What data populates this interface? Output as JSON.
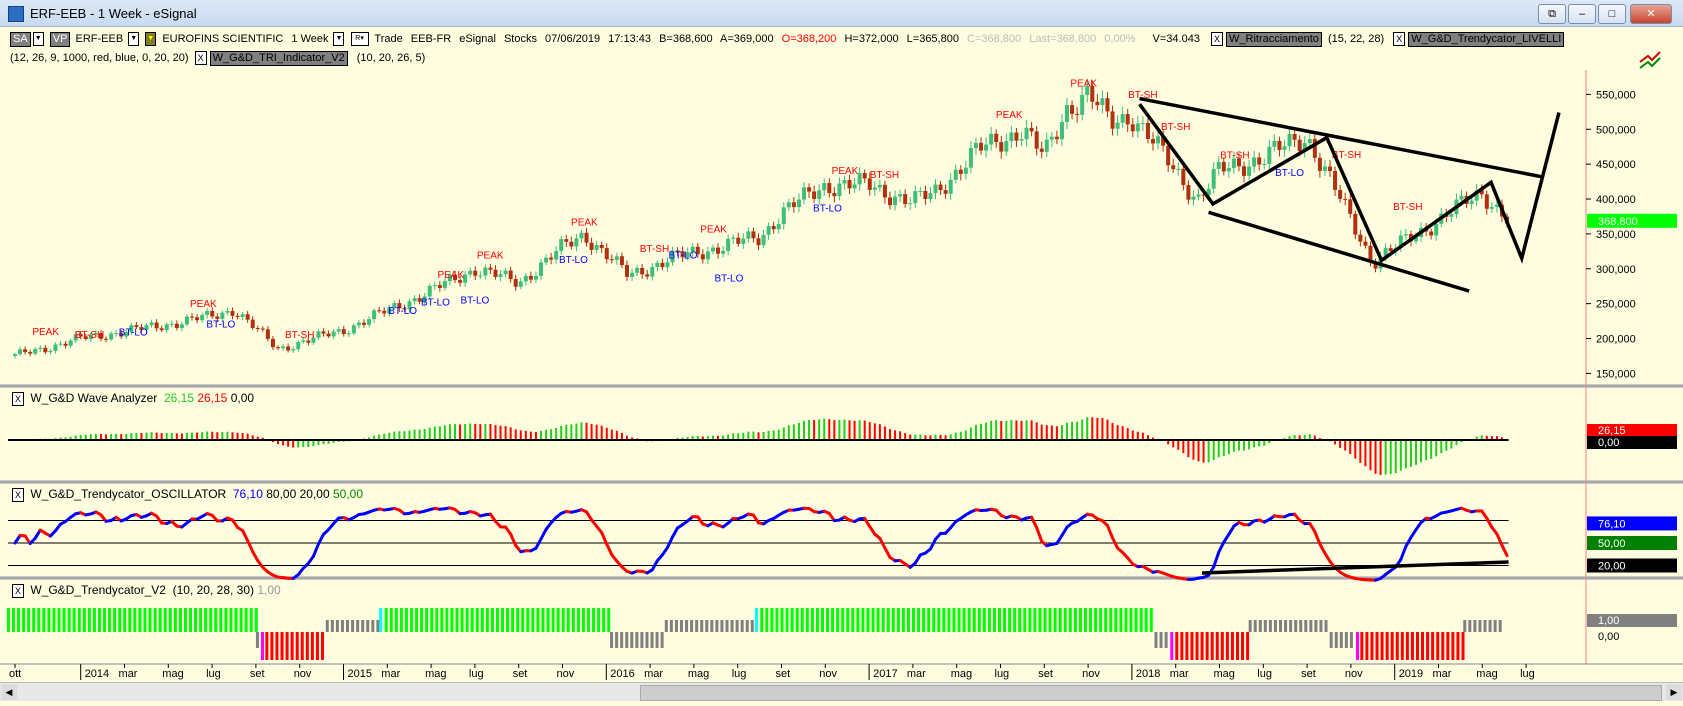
{
  "window": {
    "title": "ERF-EEB - 1 Week - eSignal",
    "buttons": [
      "⧉",
      "–",
      "□",
      "✕"
    ]
  },
  "header": {
    "sa": "SA",
    "vp": "VP",
    "symbol": "ERF-EEB",
    "name": "EUROFINS SCIENTIFIC",
    "interval": "1 Week",
    "r": "R",
    "trade": "Trade",
    "exch": "EEB-FR",
    "source": "eSignal",
    "type": "Stocks",
    "date": "07/06/2019",
    "time": "17:13:43",
    "bid": "B=368,600",
    "ask": "A=369,000",
    "open": "O=368,200",
    "high": "H=372,000",
    "low": "L=365,800",
    "close": "C=368,800",
    "last": "Last=368,800",
    "chg": "0,00%",
    "vol": "V=34.043",
    "ind1": "W_Ritracciamento",
    "ind1_params": "(15, 22, 28)",
    "ind2": "W_G&D_Trendycator_LIVELLI",
    "ind2_params": "(12, 26, 9, 1000, red, blue, 0, 20, 20)",
    "ind3": "W_G&D_TRI_Indicator_V2",
    "ind3_params": "(10, 20, 26, 5)",
    "x": "X"
  },
  "panels": {
    "wave": {
      "name": "W_G&D Wave Analyzer",
      "v1": "26,15",
      "v2": "26,15",
      "v3": "0,00"
    },
    "osc": {
      "name": "W_G&D_Trendycator_OSCILLATOR",
      "v1": "76,10",
      "v2": "80,00",
      "v3": "20,00",
      "v4": "50,00"
    },
    "v2": {
      "name": "W_G&D_Trendycator_V2",
      "params": "(10, 20, 28, 30)",
      "v1": "1,00"
    }
  },
  "colors": {
    "bg": "#fffde0",
    "up": "#3dbf7a",
    "down": "#b03010",
    "green": "#00ff00",
    "red": "#ff0000",
    "gray": "#808080",
    "blue": "#0000ff",
    "magenta": "#ff00ff",
    "cyan": "#00ffff"
  },
  "axis": {
    "price_labels": [
      {
        "v": 550,
        "t": "550,000"
      },
      {
        "v": 500,
        "t": "500,000"
      },
      {
        "v": 450,
        "t": "450,000"
      },
      {
        "v": 400,
        "t": "400,000"
      },
      {
        "v": 350,
        "t": "350,000"
      },
      {
        "v": 300,
        "t": "300,000"
      },
      {
        "v": 250,
        "t": "250,000"
      },
      {
        "v": 200,
        "t": "200,000"
      },
      {
        "v": 150,
        "t": "150,000"
      }
    ],
    "current_price": {
      "v": 368.8,
      "t": "368,800"
    },
    "wave_labels": {
      "top": "26,15",
      "zero": "0,00"
    },
    "osc_labels": {
      "a": "76,10",
      "b": "50,00",
      "c": "20,00"
    },
    "v2_labels": {
      "a": "1,00",
      "b": "0,00"
    },
    "months": [
      [
        "ott",
        0
      ],
      [
        "2014",
        3
      ],
      [
        "mar",
        5
      ],
      [
        "mag",
        7
      ],
      [
        "lug",
        9
      ],
      [
        "set",
        11
      ],
      [
        "nov",
        13
      ],
      [
        "2015",
        15
      ],
      [
        "mar",
        17
      ],
      [
        "mag",
        19
      ],
      [
        "lug",
        21
      ],
      [
        "set",
        23
      ],
      [
        "nov",
        25
      ],
      [
        "2016",
        27
      ],
      [
        "mar",
        29
      ],
      [
        "mag",
        31
      ],
      [
        "lug",
        33
      ],
      [
        "set",
        35
      ],
      [
        "nov",
        37
      ],
      [
        "2017",
        39
      ],
      [
        "mar",
        41
      ],
      [
        "mag",
        43
      ],
      [
        "lug",
        45
      ],
      [
        "set",
        47
      ],
      [
        "nov",
        49
      ],
      [
        "2018",
        51
      ],
      [
        "mar",
        53
      ],
      [
        "mag",
        55
      ],
      [
        "lug",
        57
      ],
      [
        "set",
        59
      ],
      [
        "nov",
        61
      ],
      [
        "2019",
        63
      ],
      [
        "mar",
        65
      ],
      [
        "mag",
        67
      ],
      [
        "lug",
        69
      ]
    ]
  },
  "chart_data": {
    "type": "candlestick",
    "interval": "1 Week",
    "x_unit": "months since Oct 2013",
    "y_unit": "price (thousands)",
    "price_path": [
      [
        0,
        175
      ],
      [
        3,
        200
      ],
      [
        6,
        215
      ],
      [
        9,
        232
      ],
      [
        10,
        242
      ],
      [
        12,
        185
      ],
      [
        15,
        212
      ],
      [
        17,
        240
      ],
      [
        19,
        268
      ],
      [
        21,
        300
      ],
      [
        23,
        280
      ],
      [
        25,
        330
      ],
      [
        26,
        350
      ],
      [
        28,
        290
      ],
      [
        30,
        315
      ],
      [
        32,
        330
      ],
      [
        34,
        345
      ],
      [
        35,
        380
      ],
      [
        37,
        420
      ],
      [
        39,
        420
      ],
      [
        41,
        395
      ],
      [
        42,
        410
      ],
      [
        44,
        470
      ],
      [
        46,
        500
      ],
      [
        47,
        460
      ],
      [
        48,
        530
      ],
      [
        49,
        550
      ],
      [
        50,
        510
      ],
      [
        51,
        520
      ],
      [
        52,
        480
      ],
      [
        54,
        400
      ],
      [
        55,
        440
      ],
      [
        57,
        460
      ],
      [
        59,
        490
      ],
      [
        60,
        430
      ],
      [
        61,
        370
      ],
      [
        62,
        310
      ],
      [
        63,
        330
      ],
      [
        65,
        370
      ],
      [
        67,
        410
      ],
      [
        68.2,
        369
      ]
    ],
    "labels": [
      [
        "PEAK",
        1.4,
        205
      ],
      [
        "BT-SH",
        3.4,
        201
      ],
      [
        "BT-LO",
        5.4,
        204
      ],
      [
        "PEAK",
        8.6,
        245
      ],
      [
        "BT-LO",
        9.4,
        216
      ],
      [
        "BT-SH",
        13,
        201
      ],
      [
        "BT-LO",
        17.7,
        235
      ],
      [
        "BT-LO",
        19.2,
        247
      ],
      [
        "PEAK",
        19.9,
        287
      ],
      [
        "BT-LO",
        21,
        250
      ],
      [
        "PEAK",
        21.7,
        315
      ],
      [
        "BT-LO",
        25.5,
        308
      ],
      [
        "PEAK",
        26,
        362
      ],
      [
        "BT-SH",
        29.2,
        324
      ],
      [
        "BT-LO",
        30.5,
        315
      ],
      [
        "PEAK",
        31.9,
        352
      ],
      [
        "BT-LO",
        32.6,
        282
      ],
      [
        "PEAK",
        37.9,
        436
      ],
      [
        "BT-LO",
        37.1,
        382
      ],
      [
        "BT-SH",
        39.7,
        430
      ],
      [
        "PEAK",
        45.4,
        516
      ],
      [
        "PEAK",
        48.8,
        561
      ],
      [
        "BT-SH",
        51.5,
        545
      ],
      [
        "BT-SH",
        53,
        499
      ],
      [
        "BT-SH",
        55.7,
        458
      ],
      [
        "BT-LO",
        58.2,
        433
      ],
      [
        "BT-SH",
        60.8,
        459
      ],
      [
        "BT-SH",
        63.6,
        384
      ]
    ],
    "drawings": [
      [
        [
          51.35,
          536
        ],
        [
          54.7,
          393
        ],
        [
          59.9,
          488
        ],
        [
          62.4,
          312
        ],
        [
          67.4,
          424
        ],
        [
          68.8,
          315
        ],
        [
          70.5,
          524
        ]
      ],
      [
        [
          51.35,
          544
        ],
        [
          69.7,
          432
        ]
      ],
      [
        [
          54.5,
          381
        ],
        [
          66.4,
          268
        ]
      ]
    ],
    "osc_levels": [
      80,
      50,
      20
    ],
    "osc_support": [
      [
        54.2,
        10
      ],
      [
        68.2,
        24.7
      ]
    ],
    "v2_segments": [
      [
        "green",
        -0.3,
        11.07
      ],
      [
        "graydown",
        11.07,
        11.3
      ],
      [
        "magenta",
        11.3,
        11.5
      ],
      [
        "red",
        11.5,
        14.26
      ],
      [
        "grayup",
        14.26,
        16.7
      ],
      [
        "cyan",
        16.7,
        16.95
      ],
      [
        "green",
        16.95,
        27.24
      ],
      [
        "graydown",
        27.24,
        29.74
      ],
      [
        "grayup",
        29.74,
        33.86
      ],
      [
        "cyan",
        33.86,
        34.1
      ],
      [
        "green",
        34.1,
        52.1
      ],
      [
        "graydown",
        52.1,
        52.82
      ],
      [
        "magenta",
        52.82,
        53.05
      ],
      [
        "red",
        53.05,
        56.4
      ],
      [
        "grayup",
        56.4,
        60.1
      ],
      [
        "graydown",
        60.1,
        61.3
      ],
      [
        "magenta",
        61.3,
        61.5
      ],
      [
        "red",
        61.5,
        66.2
      ],
      [
        "grayup",
        66.2,
        67.9
      ]
    ]
  }
}
